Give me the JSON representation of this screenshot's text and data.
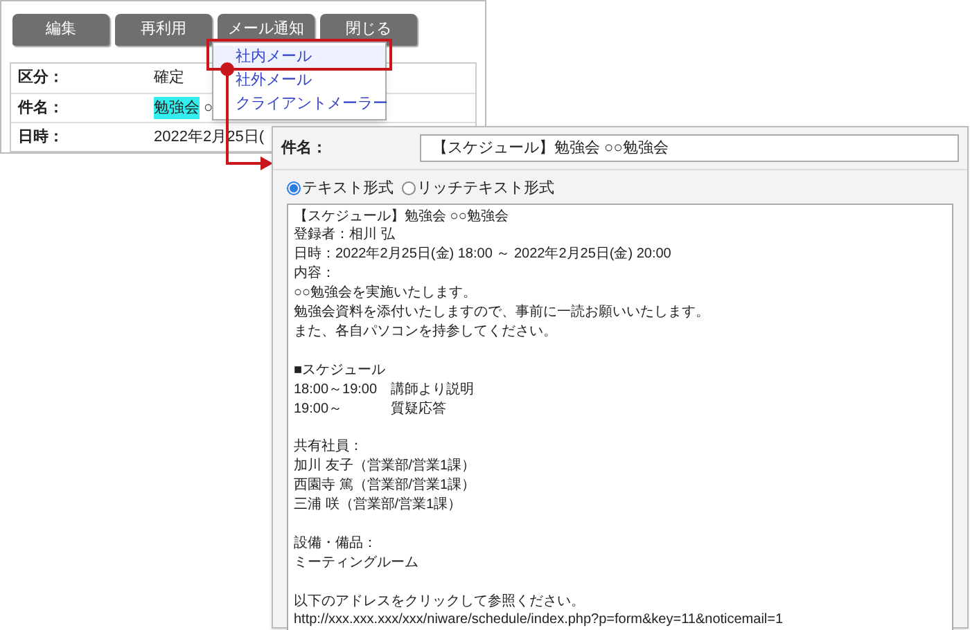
{
  "toolbar": {
    "buttons": [
      "編集",
      "再利用",
      "メール通知",
      "閉じる"
    ]
  },
  "details": [
    {
      "label": "区分：",
      "value": "確定"
    },
    {
      "label": "件名：",
      "highlight": "勉強会",
      "value": "○"
    },
    {
      "label": "日時：",
      "value": "2022年2月25日("
    }
  ],
  "mail_menu": {
    "items": [
      {
        "label": "社内メール",
        "selected": true
      },
      {
        "label": "社外メール",
        "selected": false
      },
      {
        "label": "クライアントメーラー",
        "selected": false
      }
    ]
  },
  "mail_form": {
    "subject_label": "件名：",
    "subject": "【スケジュール】勉強会 ○○勉強会",
    "formats": [
      {
        "label": "テキスト形式",
        "selected": true
      },
      {
        "label": "リッチテキスト形式",
        "selected": false
      }
    ],
    "body": [
      {
        "kind": "text",
        "lines": [
          "【スケジュール】勉強会 ○○勉強会",
          "登録者：相川 弘",
          "日時：2022年2月25日(金) 18:00 ～ 2022年2月25日(金) 20:00",
          "内容：",
          "○○勉強会を実施いたします。",
          "勉強会資料を添付いたしますので、事前に一読お願いいたします。",
          "また、各自パソコンを持参してください。"
        ]
      },
      {
        "kind": "schedule",
        "title": "■スケジュール",
        "rows": [
          {
            "time": "18:00～19:00",
            "item": "講師より説明"
          },
          {
            "time": "19:00～",
            "item": "質疑応答"
          }
        ]
      },
      {
        "kind": "text",
        "lines": [
          "共有社員：",
          "加川 友子（営業部/営業1課）",
          "西園寺 篤（営業部/営業1課）",
          "三浦 咲（営業部/営業1課）"
        ]
      },
      {
        "kind": "text",
        "lines": [
          "設備・備品：",
          "ミーティングルーム"
        ]
      },
      {
        "kind": "text",
        "lines": [
          "以下のアドレスをクリックして参照ください。",
          "http://xxx.xxx.xxx/xxx/niware/schedule/index.php?p=form&key=11&noticemail=1"
        ]
      }
    ]
  }
}
